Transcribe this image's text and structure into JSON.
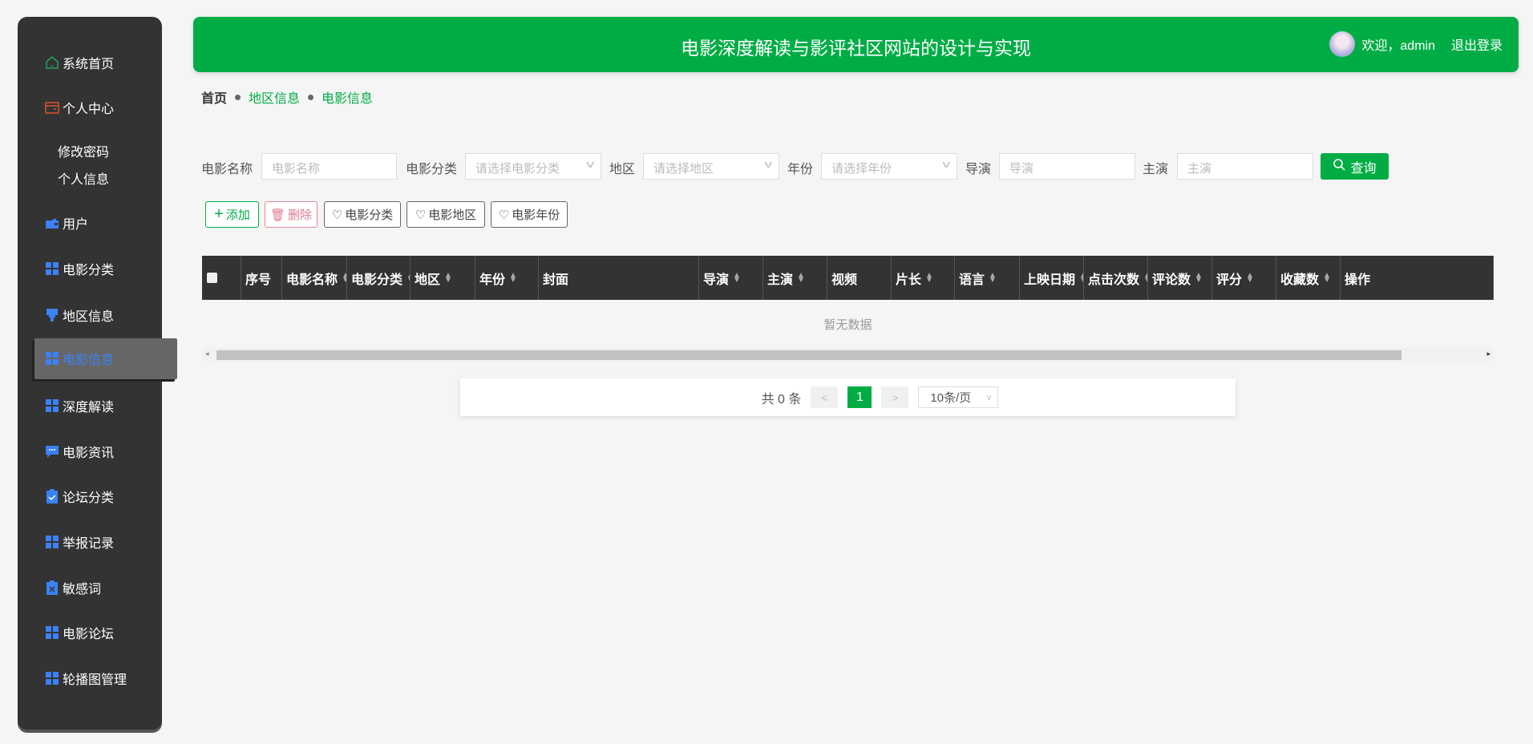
{
  "sidebar": {
    "items": [
      {
        "label": "系统首页",
        "icon": "home-icon"
      },
      {
        "label": "个人中心",
        "icon": "wallet-icon"
      },
      {
        "label": "用户",
        "icon": "user-icon"
      },
      {
        "label": "电影分类",
        "icon": "grid-icon"
      },
      {
        "label": "地区信息",
        "icon": "brush-icon"
      },
      {
        "label": "电影信息",
        "icon": "grid-icon"
      },
      {
        "label": "深度解读",
        "icon": "grid-icon"
      },
      {
        "label": "电影资讯",
        "icon": "chat-icon"
      },
      {
        "label": "论坛分类",
        "icon": "clipboard-check-icon"
      },
      {
        "label": "举报记录",
        "icon": "grid-icon"
      },
      {
        "label": "敏感词",
        "icon": "clipboard-x-icon"
      },
      {
        "label": "电影论坛",
        "icon": "grid-icon"
      },
      {
        "label": "轮播图管理",
        "icon": "grid-icon"
      }
    ],
    "sub": [
      "修改密码",
      "个人信息"
    ]
  },
  "header": {
    "title": "电影深度解读与影评社区网站的设计与实现",
    "welcome": "欢迎，admin",
    "logout": "退出登录"
  },
  "breadcrumb": [
    "首页",
    "地区信息",
    "电影信息"
  ],
  "search": {
    "fields": [
      {
        "label": "电影名称",
        "placeholder": "电影名称"
      },
      {
        "label": "电影分类",
        "placeholder": "请选择电影分类"
      },
      {
        "label": "地区",
        "placeholder": "请选择地区"
      },
      {
        "label": "年份",
        "placeholder": "请选择年份"
      },
      {
        "label": "导演",
        "placeholder": "导演"
      },
      {
        "label": "主演",
        "placeholder": "主演"
      }
    ],
    "button": "查询"
  },
  "actions": [
    "添加",
    "删除",
    "电影分类",
    "电影地区",
    "电影年份"
  ],
  "table": {
    "columns": [
      "",
      "序号",
      "电影名称",
      "电影分类",
      "地区",
      "年份",
      "封面",
      "导演",
      "主演",
      "视频",
      "片长",
      "语言",
      "上映日期",
      "点击次数",
      "评论数",
      "评分",
      "收藏数",
      "操作"
    ],
    "empty": "暂无数据"
  },
  "pagination": {
    "total": "共 0 条",
    "page": "1",
    "prev": "<",
    "next": ">",
    "size": "10条/页"
  },
  "colors": {
    "accent": "#00ad45",
    "sidebar": "#333333",
    "active": "#3b82f6"
  }
}
